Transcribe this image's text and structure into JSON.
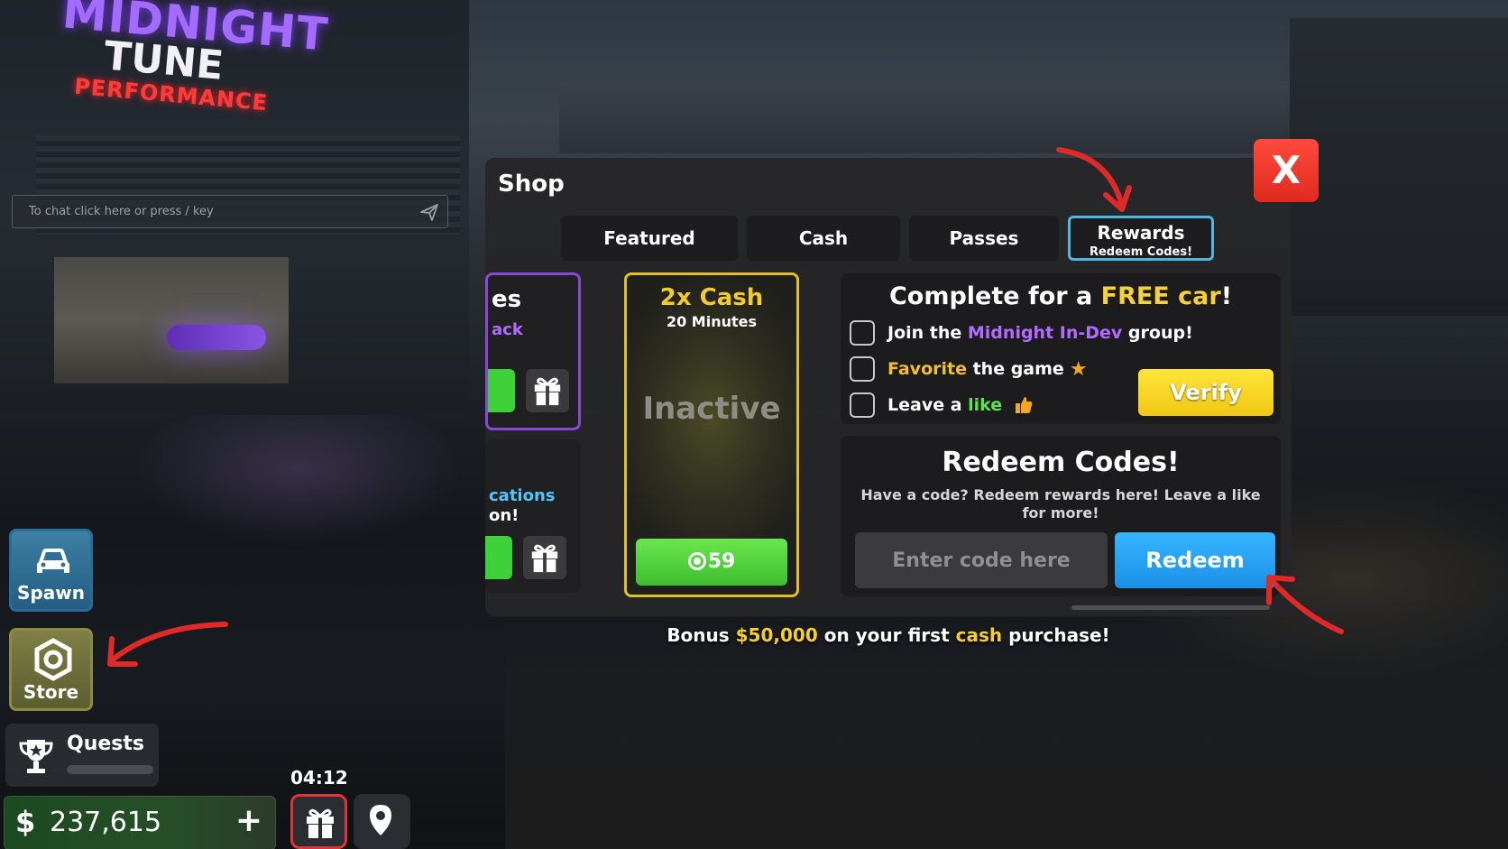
{
  "background": {
    "sign": {
      "line1": "MIDNIGHT",
      "line2": "TUNE",
      "line3": "PERFORMANCE"
    }
  },
  "chat": {
    "placeholder": "To chat click here or press / key"
  },
  "sidebar": {
    "spawn_label": "Spawn",
    "store_label": "Store",
    "quests_label": "Quests"
  },
  "hud": {
    "money_symbol": "$",
    "money_value": "237,615",
    "add_symbol": "+",
    "gift_timer": "04:12"
  },
  "shop": {
    "title": "Shop",
    "tabs": [
      {
        "label": "Featured"
      },
      {
        "label": "Cash"
      },
      {
        "label": "Passes"
      },
      {
        "label": "Rewards",
        "sublabel": "Redeem Codes!"
      }
    ],
    "partial_cards": {
      "top_line1": "es",
      "top_line2": "ack",
      "bottom_line1": "cations",
      "bottom_line2": "on!"
    },
    "boost_card": {
      "title": "2x Cash",
      "duration": "20 Minutes",
      "status": "Inactive",
      "price": "59"
    },
    "free_car": {
      "title_prefix": "Complete for a ",
      "title_highlight": "FREE car",
      "title_suffix": "!",
      "tasks": [
        {
          "pre": "Join the ",
          "highlight": "Midnight In-Dev",
          "post": " group!"
        },
        {
          "pre": "",
          "highlight": "Favorite",
          "post": " the game"
        },
        {
          "pre": "Leave a ",
          "highlight": "like",
          "post": ""
        }
      ],
      "verify_label": "Verify"
    },
    "redeem": {
      "title": "Redeem Codes!",
      "description": "Have a code? Redeem rewards here! Leave a like for more!",
      "input_placeholder": "Enter code here",
      "button_label": "Redeem"
    },
    "close_label": "X"
  },
  "bonus": {
    "prefix": "Bonus ",
    "amount": "$50,000",
    "middle": " on your first ",
    "cash_word": "cash",
    "suffix": " purchase!"
  },
  "colors": {
    "rewards_tab_border": "#4fb6e0",
    "boost_border": "#e2c021",
    "verify": "#ffe43a",
    "redeem": "#36b5ff",
    "close": "#ff4a3c",
    "annotation_arrows": "#e02a2a"
  }
}
